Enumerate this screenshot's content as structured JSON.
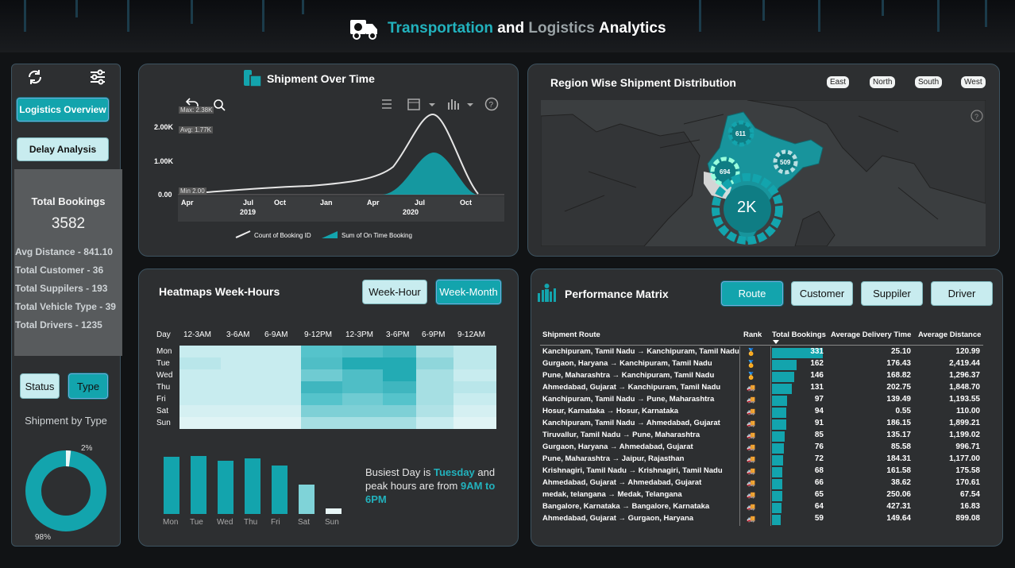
{
  "header": {
    "title_part1": "Transportation",
    "title_part2": "and",
    "title_part3": "Logistics",
    "title_part4": "Analytics"
  },
  "sidebar": {
    "nav_logistics": "Logistics Overview",
    "nav_delay": "Delay Analysis",
    "total_bookings_label": "Total Bookings",
    "total_bookings_value": "3582",
    "avg_distance": "Avg Distance - 841.10",
    "total_customer": "Total Customer - 36",
    "total_suppliers": "Total Suppilers - 193",
    "total_vehicle_type": "Total Vehicle Type - 39",
    "total_drivers": "Total Drivers - 1235",
    "toggle_status": "Status",
    "toggle_type": "Type",
    "shipment_by_type_title": "Shipment by Type",
    "donut_small_label": "2%",
    "donut_large_label": "98%"
  },
  "shipment_over_time": {
    "title": "Shipment Over Time",
    "y_ticks": [
      "2.00K",
      "1.00K",
      "0.00"
    ],
    "max_label": "Max: 2.38K",
    "avg_label": "Avg: 1.77K",
    "min_label": "Min 2.00",
    "x_months": [
      "Apr",
      "Jul",
      "Oct",
      "Jan",
      "Apr",
      "Jul",
      "Oct"
    ],
    "x_years": [
      "2019",
      "2020"
    ],
    "legend_count": "Count of Booking ID",
    "legend_ontime": "Sum of On Time Booking"
  },
  "region": {
    "title": "Region Wise Shipment Distribution",
    "filters": [
      "East",
      "North",
      "South",
      "West"
    ],
    "bubble_north": "611",
    "bubble_west": "694",
    "bubble_east": "509",
    "bubble_south": "2K"
  },
  "heatmap": {
    "title": "Heatmaps Week-Hours",
    "btn_week_hour": "Week-Hour",
    "btn_week_month": "Week-Month",
    "day_header": "Day",
    "hours": [
      "12-3AM",
      "3-6AM",
      "6-9AM",
      "9-12PM",
      "12-3PM",
      "3-6PM",
      "6-9PM",
      "9-12AM"
    ],
    "days": [
      "Mon",
      "Tue",
      "Wed",
      "Thu",
      "Fri",
      "Sat",
      "Sun"
    ],
    "insight_prefix": "Busiest Day is",
    "insight_day": "Tuesday",
    "insight_mid": "and peak hours are from",
    "insight_hours": "9AM to 6PM"
  },
  "bar_chart_days": {
    "categories": [
      "Mon",
      "Tue",
      "Wed",
      "Thu",
      "Fri",
      "Sat",
      "Sun"
    ]
  },
  "performance": {
    "title": "Performance Matrix",
    "tabs": [
      "Route",
      "Customer",
      "Suppiler",
      "Driver"
    ],
    "columns": [
      "Shipment Route",
      "Rank",
      "Total Bookings",
      "Average Delivery Time",
      "Average Distance"
    ],
    "rows": [
      {
        "route": "Kanchipuram, Tamil Nadu → Kanchipuram, Tamil Nadu",
        "bookings": "331",
        "time": "25.10",
        "dist": "120.99"
      },
      {
        "route": "Gurgaon, Haryana → Kanchipuram, Tamil Nadu",
        "bookings": "162",
        "time": "176.43",
        "dist": "2,419.44"
      },
      {
        "route": "Pune, Maharashtra → Kanchipuram, Tamil Nadu",
        "bookings": "146",
        "time": "168.82",
        "dist": "1,296.37"
      },
      {
        "route": "Ahmedabad, Gujarat → Kanchipuram, Tamil Nadu",
        "bookings": "131",
        "time": "202.75",
        "dist": "1,848.70"
      },
      {
        "route": "Kanchipuram, Tamil Nadu → Pune, Maharashtra",
        "bookings": "97",
        "time": "139.49",
        "dist": "1,193.55"
      },
      {
        "route": "Hosur, Karnataka → Hosur, Karnataka",
        "bookings": "94",
        "time": "0.55",
        "dist": "110.00"
      },
      {
        "route": "Kanchipuram, Tamil Nadu → Ahmedabad, Gujarat",
        "bookings": "91",
        "time": "186.15",
        "dist": "1,899.21"
      },
      {
        "route": "Tiruvallur, Tamil Nadu → Pune, Maharashtra",
        "bookings": "85",
        "time": "135.17",
        "dist": "1,199.02"
      },
      {
        "route": "Gurgaon, Haryana → Ahmedabad, Gujarat",
        "bookings": "76",
        "time": "85.58",
        "dist": "996.71"
      },
      {
        "route": "Pune, Maharashtra → Jaipur, Rajasthan",
        "bookings": "72",
        "time": "184.31",
        "dist": "1,177.00"
      },
      {
        "route": "Krishnagiri, Tamil Nadu → Krishnagiri, Tamil Nadu",
        "bookings": "68",
        "time": "161.58",
        "dist": "175.58"
      },
      {
        "route": "Ahmedabad, Gujarat → Ahmedabad, Gujarat",
        "bookings": "66",
        "time": "38.62",
        "dist": "170.61"
      },
      {
        "route": "medak, telangana → Medak, Telangana",
        "bookings": "65",
        "time": "250.06",
        "dist": "67.54"
      },
      {
        "route": "Bangalore, Karnataka → Bangalore, Karnataka",
        "bookings": "64",
        "time": "427.31",
        "dist": "16.83"
      },
      {
        "route": "Ahmedabad, Gujarat → Gurgaon, Haryana",
        "bookings": "59",
        "time": "149.64",
        "dist": "899.08"
      }
    ]
  },
  "colors": {
    "accent": "#13a4ad",
    "panel": "#2d2f31",
    "background": "#111315",
    "light": "#c8ecef"
  }
}
